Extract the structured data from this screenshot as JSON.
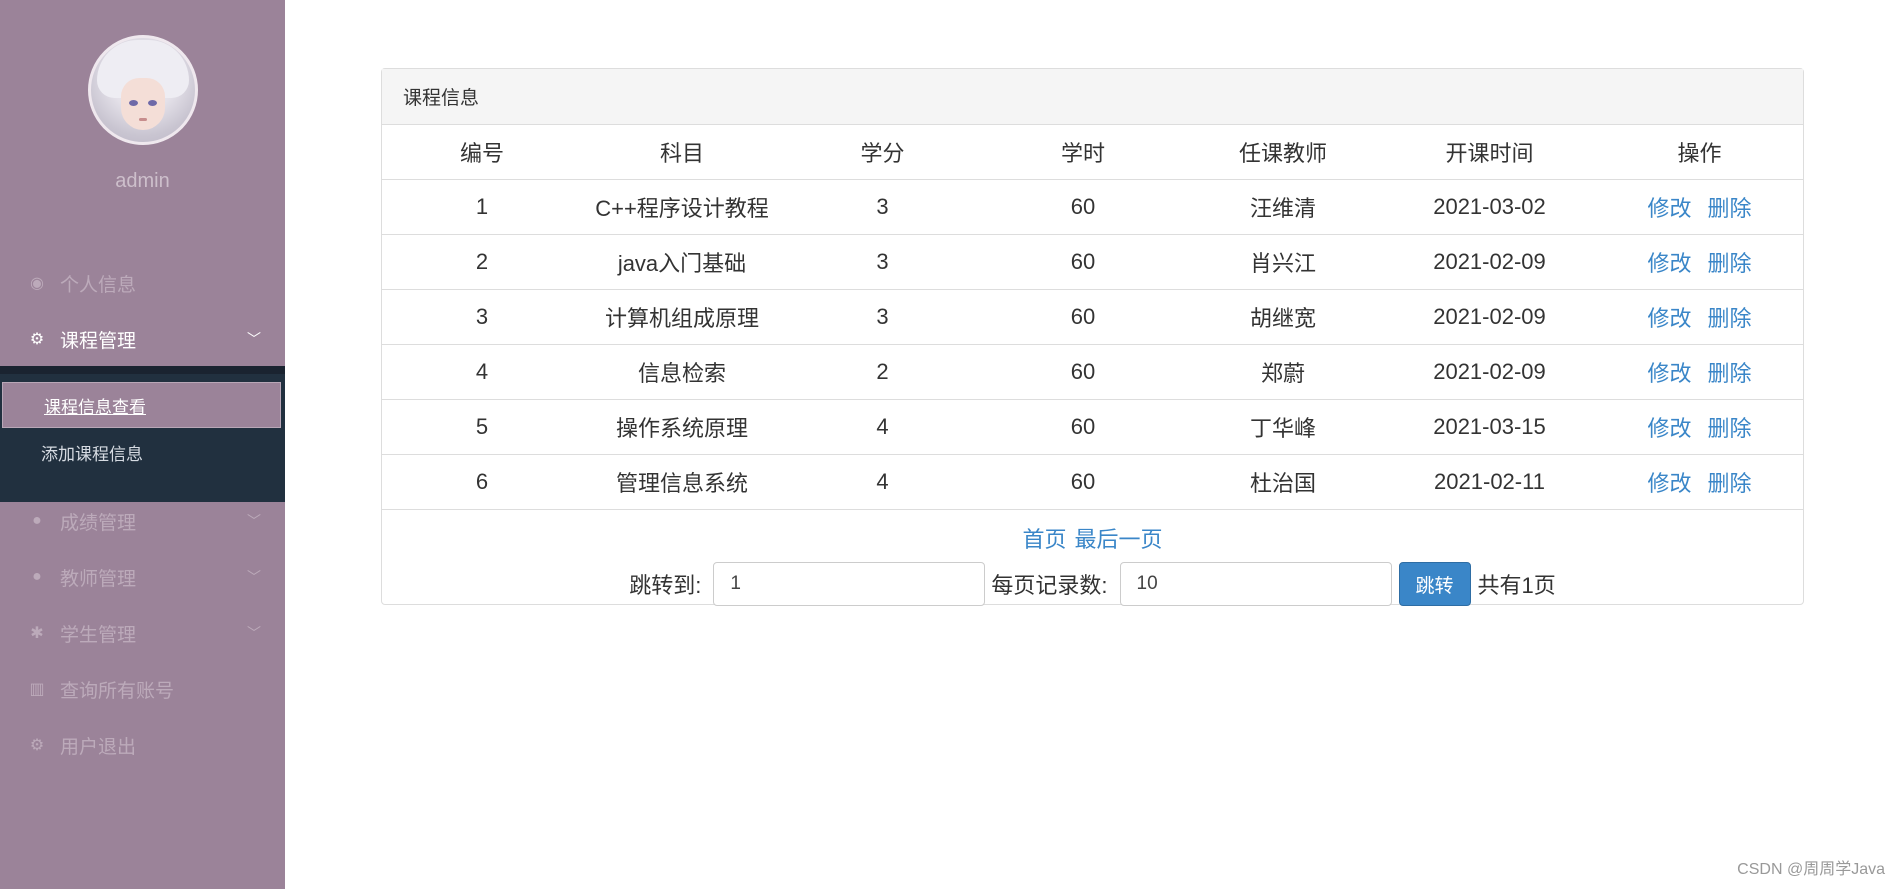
{
  "sidebar": {
    "username": "admin",
    "menu": [
      {
        "label": "个人信息",
        "icon": "dashboard-icon"
      },
      {
        "label": "课程管理",
        "icon": "gears-icon"
      },
      {
        "label": "成绩管理",
        "icon": "comments-icon"
      },
      {
        "label": "教师管理",
        "icon": "users-icon"
      },
      {
        "label": "学生管理",
        "icon": "bug-icon"
      },
      {
        "label": "查询所有账号",
        "icon": "bank-icon"
      },
      {
        "label": "用户退出",
        "icon": "gears-icon"
      }
    ],
    "submenu": [
      {
        "label": "课程信息查看"
      },
      {
        "label": "添加课程信息"
      }
    ]
  },
  "panel": {
    "title": "课程信息",
    "columns": [
      "编号",
      "科目",
      "学分",
      "学时",
      "任课教师",
      "开课时间",
      "操作"
    ],
    "rows": [
      {
        "id": "1",
        "subject": "C++程序设计教程",
        "credit": "3",
        "hours": "60",
        "teacher": "汪维清",
        "date": "2021-03-02"
      },
      {
        "id": "2",
        "subject": "java入门基础",
        "credit": "3",
        "hours": "60",
        "teacher": "肖兴江",
        "date": "2021-02-09"
      },
      {
        "id": "3",
        "subject": "计算机组成原理",
        "credit": "3",
        "hours": "60",
        "teacher": "胡继宽",
        "date": "2021-02-09"
      },
      {
        "id": "4",
        "subject": "信息检索",
        "credit": "2",
        "hours": "60",
        "teacher": "郑蔚",
        "date": "2021-02-09"
      },
      {
        "id": "5",
        "subject": "操作系统原理",
        "credit": "4",
        "hours": "60",
        "teacher": "丁华峰",
        "date": "2021-03-15"
      },
      {
        "id": "6",
        "subject": "管理信息系统",
        "credit": "4",
        "hours": "60",
        "teacher": "杜治国",
        "date": "2021-02-11"
      }
    ],
    "edit_label": "修改",
    "delete_label": "删除"
  },
  "pager": {
    "first_label": "首页",
    "last_label": "最后一页",
    "jump_label": "跳转到:",
    "jump_value": "1",
    "per_page_label": "每页记录数:",
    "per_page_value": "10",
    "go_label": "跳转",
    "total_label": "共有1页"
  },
  "watermark": "CSDN @周周学Java"
}
